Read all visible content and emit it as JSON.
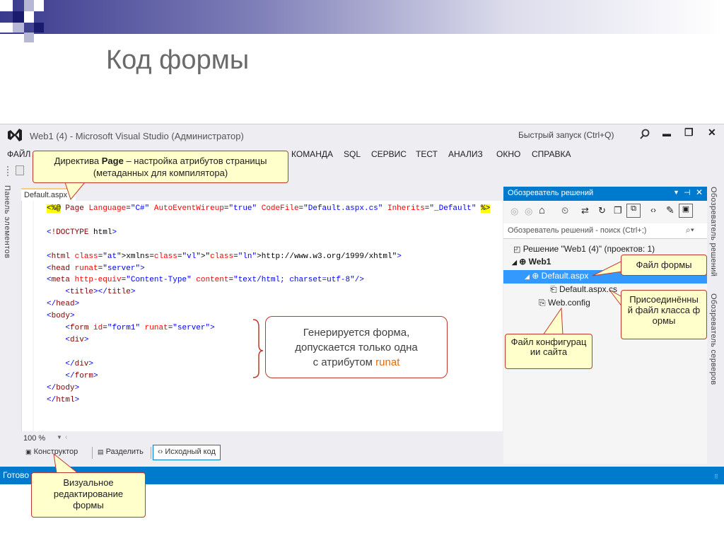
{
  "slide": {
    "title": "Код формы"
  },
  "window": {
    "title": "Web1 (4) - Microsoft Visual Studio (Администратор)",
    "quick_launch": "Быстрый запуск (Ctrl+Q)",
    "controls": [
      "▬",
      "❐",
      "✕"
    ]
  },
  "menu": [
    "ФАЙЛ",
    "КОМАНДА",
    "SQL",
    "СЕРВИС",
    "ТЕСТ",
    "АНАЛИЗ",
    "ОКНО",
    "СПРАВКА"
  ],
  "left_panel_label": "Панель элементов",
  "right_panel_labels": [
    "Обозреватель решений",
    "Обозреватель серверов"
  ],
  "editor": {
    "tab": "Default.aspx",
    "tab_pin": "↓",
    "zoom": "100 %",
    "code_lines": [
      "<%@ Page Language=\"C#\" AutoEventWireup=\"true\" CodeFile=\"Default.aspx.cs\" Inherits=\"_Default\" %>",
      "",
      "<!DOCTYPE html>",
      "",
      "<html xmlns=\"http://www.w3.org/1999/xhtml\">",
      "<head runat=\"server\">",
      "<meta http-equiv=\"Content-Type\" content=\"text/html; charset=utf-8\"/>",
      "    <title></title>",
      "</head>",
      "<body>",
      "    <form id=\"form1\" runat=\"server\">",
      "    <div>",
      "",
      "    </div>",
      "    </form>",
      "</body>",
      "</html>"
    ],
    "views": {
      "design": "Конструктор",
      "split": "Разделить",
      "source": "Исходный код"
    }
  },
  "status": "Готово",
  "solution_explorer": {
    "title": "Обозреватель решений",
    "search": "Обозреватель решений - поиск (Ctrl+;)",
    "solution": "Решение \"Web1 (4)\"  (проектов: 1)",
    "project": "Web1",
    "items": [
      "Default.aspx",
      "Default.aspx.cs",
      "Web.config"
    ]
  },
  "callouts": {
    "directive_pre": "Директива ",
    "directive_bold": "Page",
    "directive_post": " – настройка атрибутов страницы (метаданных для компилятора)",
    "form_generated_1": "Генерируется форма,",
    "form_generated_2": "допускается только одна",
    "form_generated_3": "с атрибутом ",
    "form_generated_runat": "runat",
    "form_file": "Файл формы",
    "codebehind": "Присоединённый файл класса формы",
    "config": "Файл конфигурации сайта",
    "visual": "Визуальное редактирование формы"
  },
  "colors": {
    "accent": "#007acc",
    "selection": "#3399ff",
    "callout_border": "#c0392b",
    "runat": "#e36c09"
  }
}
